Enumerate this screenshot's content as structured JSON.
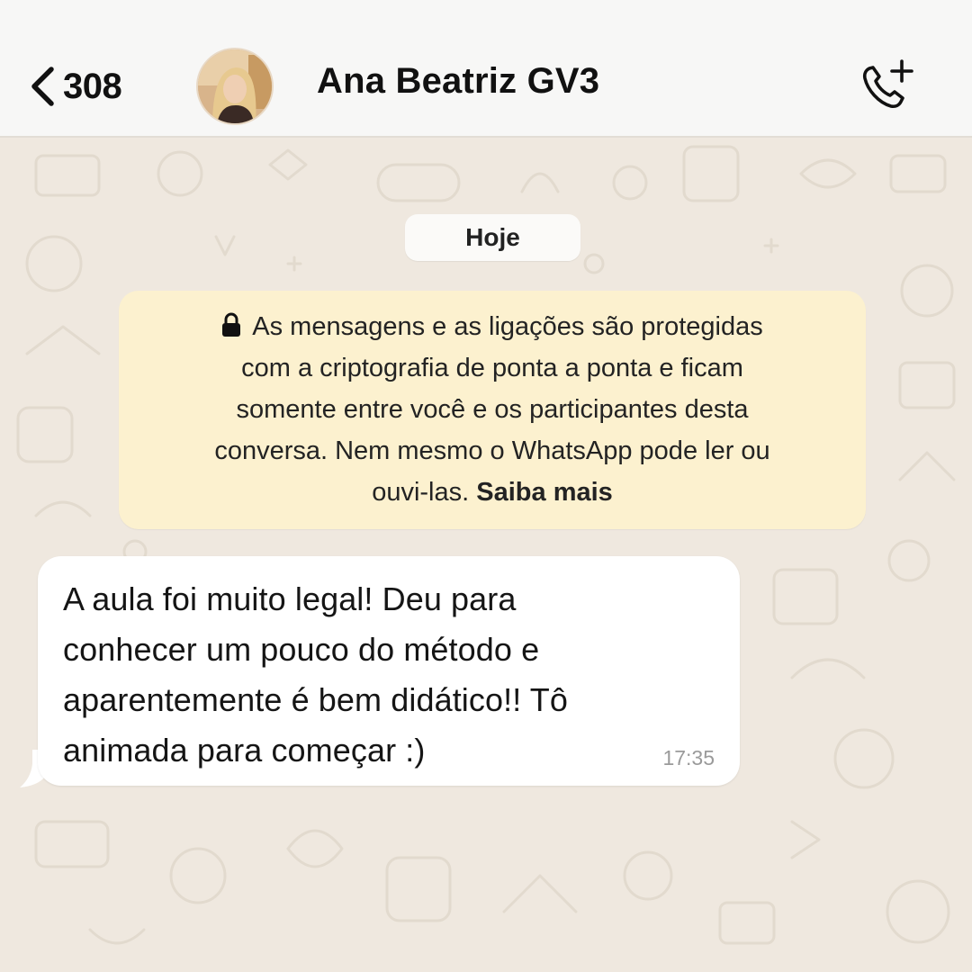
{
  "header": {
    "back_count": "308",
    "contact_name": "Ana Beatriz GV3"
  },
  "icons": {
    "back": "chevron-left-icon",
    "call_add": "phone-plus-icon",
    "lock": "lock-icon"
  },
  "chat": {
    "date_label": "Hoje",
    "encryption_notice": {
      "lines": [
        "As mensagens e as ligações são protegidas",
        "com a criptografia de ponta a ponta e ficam",
        "somente entre você e os participantes desta",
        "conversa. Nem mesmo o WhatsApp pode ler ou",
        "ouvi-las."
      ],
      "learn_more": "Saiba mais"
    },
    "messages": [
      {
        "lines": [
          "A aula foi muito legal! Deu para",
          "conhecer um pouco do método e",
          "aparentemente é bem didático!! Tô",
          "animada para começar :)"
        ],
        "time": "17:35"
      }
    ]
  },
  "colors": {
    "header_bg": "#f7f7f6",
    "chat_bg": "#efe8df",
    "notice_bg": "#fcf1cf",
    "bubble_bg": "#ffffff",
    "time_text": "#9a9a9a"
  }
}
